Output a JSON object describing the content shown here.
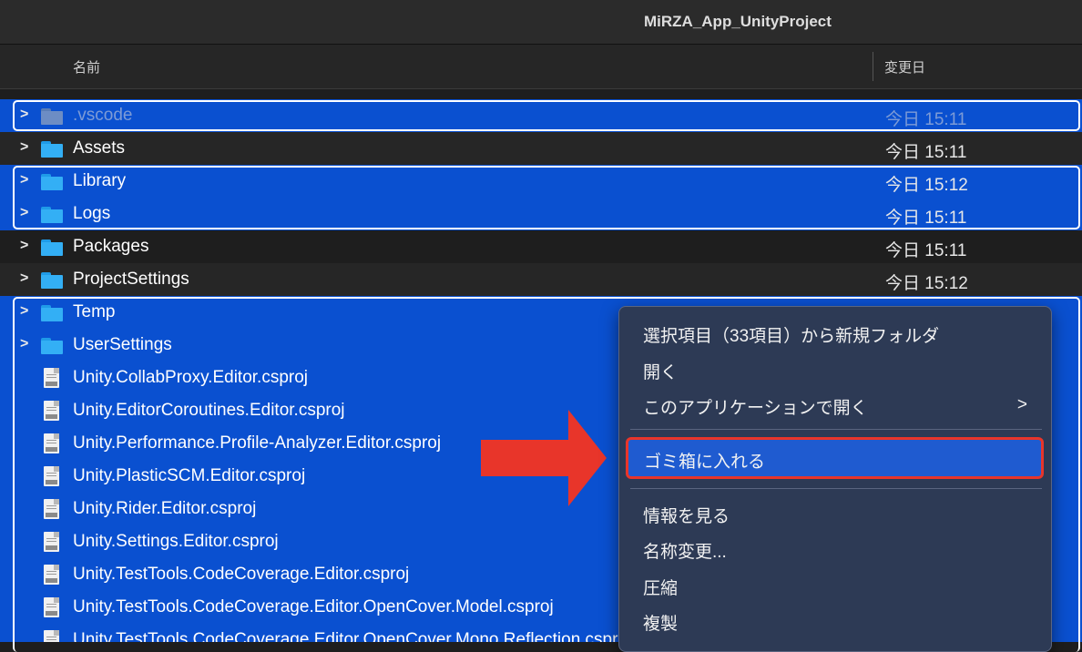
{
  "window": {
    "title": "MiRZA_App_UnityProject"
  },
  "columns": {
    "name": "名前",
    "date": "変更日"
  },
  "rows": [
    {
      "name": ".vscode",
      "date": "今日 15:11",
      "kind": "folder"
    },
    {
      "name": "Assets",
      "date": "今日 15:11",
      "kind": "folder"
    },
    {
      "name": "Library",
      "date": "今日 15:12",
      "kind": "folder"
    },
    {
      "name": "Logs",
      "date": "今日 15:11",
      "kind": "folder"
    },
    {
      "name": "Packages",
      "date": "今日 15:11",
      "kind": "folder"
    },
    {
      "name": "ProjectSettings",
      "date": "今日 15:12",
      "kind": "folder"
    },
    {
      "name": "Temp",
      "date": "",
      "kind": "folder"
    },
    {
      "name": "UserSettings",
      "date": "",
      "kind": "folder"
    },
    {
      "name": "Unity.CollabProxy.Editor.csproj",
      "kind": "file"
    },
    {
      "name": "Unity.EditorCoroutines.Editor.csproj",
      "kind": "file"
    },
    {
      "name": "Unity.Performance.Profile-Analyzer.Editor.csproj",
      "kind": "file"
    },
    {
      "name": "Unity.PlasticSCM.Editor.csproj",
      "kind": "file"
    },
    {
      "name": "Unity.Rider.Editor.csproj",
      "kind": "file"
    },
    {
      "name": "Unity.Settings.Editor.csproj",
      "kind": "file"
    },
    {
      "name": "Unity.TestTools.CodeCoverage.Editor.csproj",
      "kind": "file"
    },
    {
      "name": "Unity.TestTools.CodeCoverage.Editor.OpenCover.Model.csproj",
      "kind": "file"
    },
    {
      "name": "Unity.TestTools.CodeCoverage.Editor.OpenCover.Mono.Reflection.csproj",
      "kind": "file"
    }
  ],
  "context_menu": {
    "new_folder": "選択項目（33項目）から新規フォルダ",
    "open": "開く",
    "open_with": "このアプリケーションで開く",
    "open_with_chevron": ">",
    "move_to_trash": "ゴミ箱に入れる",
    "get_info": "情報を見る",
    "rename": "名称変更...",
    "compress": "圧縮",
    "duplicate": "複製"
  },
  "colors": {
    "selection": "#0a50d0",
    "highlight_border": "#e8352a",
    "arrow": "#e8352a"
  }
}
